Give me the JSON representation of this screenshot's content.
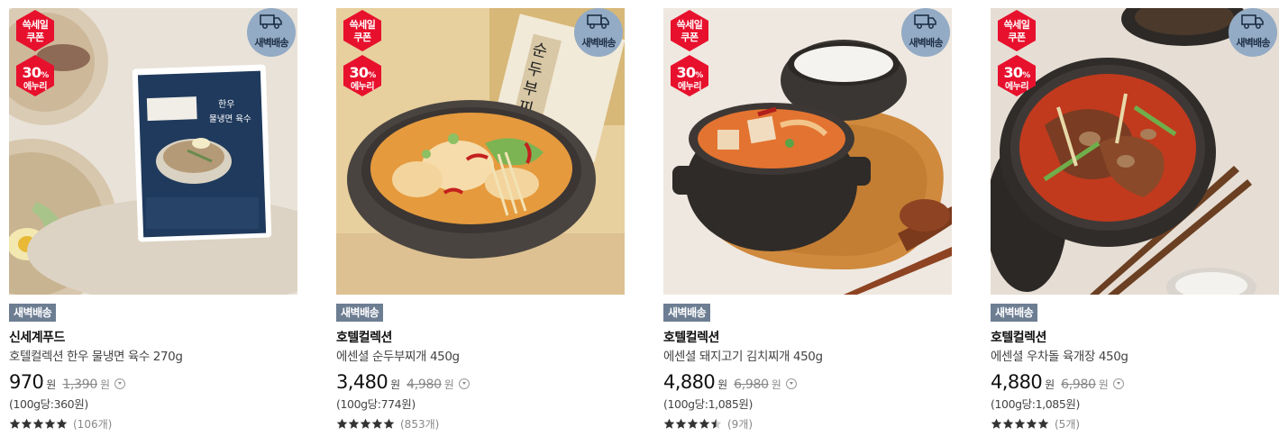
{
  "colors": {
    "sale_badge": "#e8112d",
    "dawn_badge": "#93abc4",
    "tag": "#6d7e93",
    "star": "#333333"
  },
  "icons": {
    "delivery": "truck-icon",
    "info": "chevron-down-circle-icon",
    "star": "star-icon"
  },
  "products": [
    {
      "badge": {
        "line1": "쓱세일",
        "line2": "쿠폰",
        "percent": "30",
        "percent_unit": "%",
        "sub": "에누리"
      },
      "delivery_badge": "새벽배송",
      "tag": "새벽배송",
      "brand": "신세계푸드",
      "name": "호텔컬렉션 한우 물냉면 육수 270g",
      "price": "970",
      "price_unit": "원",
      "original_price": "1,390",
      "original_unit": "원",
      "unit_price": "(100g당:360원)",
      "rating": 5,
      "review_count": "(106개)"
    },
    {
      "badge": {
        "line1": "쓱세일",
        "line2": "쿠폰",
        "percent": "30",
        "percent_unit": "%",
        "sub": "에누리"
      },
      "delivery_badge": "새벽배송",
      "tag": "새벽배송",
      "brand": "호텔컬렉션",
      "name": "에센셜 순두부찌개 450g",
      "price": "3,480",
      "price_unit": "원",
      "original_price": "4,980",
      "original_unit": "원",
      "unit_price": "(100g당:774원)",
      "rating": 5,
      "review_count": "(853개)"
    },
    {
      "badge": {
        "line1": "쓱세일",
        "line2": "쿠폰",
        "percent": "30",
        "percent_unit": "%",
        "sub": "에누리"
      },
      "delivery_badge": "새벽배송",
      "tag": "새벽배송",
      "brand": "호텔컬렉션",
      "name": "에센셜 돼지고기 김치찌개 450g",
      "price": "4,880",
      "price_unit": "원",
      "original_price": "6,980",
      "original_unit": "원",
      "unit_price": "(100g당:1,085원)",
      "rating": 4.5,
      "review_count": "(9개)"
    },
    {
      "badge": {
        "line1": "쓱세일",
        "line2": "쿠폰",
        "percent": "30",
        "percent_unit": "%",
        "sub": "에누리"
      },
      "delivery_badge": "새벽배송",
      "tag": "새벽배송",
      "brand": "호텔컬렉션",
      "name": "에센셜 우차돌 육개장 450g",
      "price": "4,880",
      "price_unit": "원",
      "original_price": "6,980",
      "original_unit": "원",
      "unit_price": "(100g당:1,085원)",
      "rating": 5,
      "review_count": "(5개)"
    }
  ]
}
